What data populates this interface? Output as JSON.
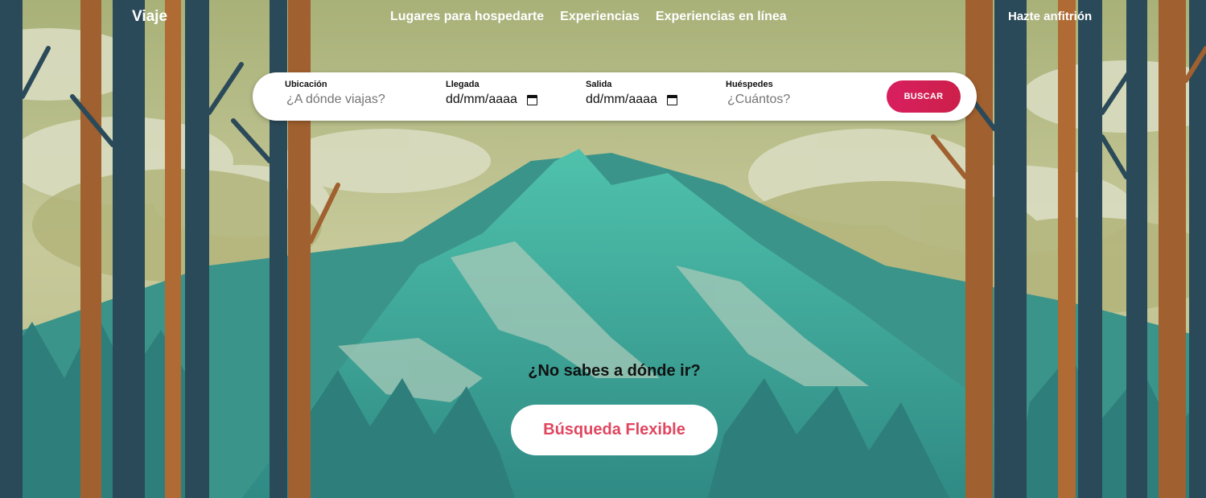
{
  "header": {
    "brand": "Viaje",
    "nav": [
      {
        "label": "Lugares para hospedarte"
      },
      {
        "label": "Experiencias"
      },
      {
        "label": "Experiencias en línea"
      }
    ],
    "host_link": "Hazte anfitrión"
  },
  "search": {
    "location": {
      "label": "Ubicación",
      "placeholder": "¿A dónde viajas?"
    },
    "checkin": {
      "label": "Llegada",
      "value": "dd/mm/aaaa"
    },
    "checkout": {
      "label": "Salida",
      "value": "dd/mm/aaaa"
    },
    "guests": {
      "label": "Huéspedes",
      "placeholder": "¿Cuántos?"
    },
    "button": "BUSCAR"
  },
  "cta": {
    "title": "¿No sabes a dónde ir?",
    "button": "Búsqueda Flexible"
  },
  "colors": {
    "accent": "#d81f5f",
    "flex_text": "#e0465f",
    "sky": "#b4bd8a",
    "mountain": "#3f9a8e"
  }
}
